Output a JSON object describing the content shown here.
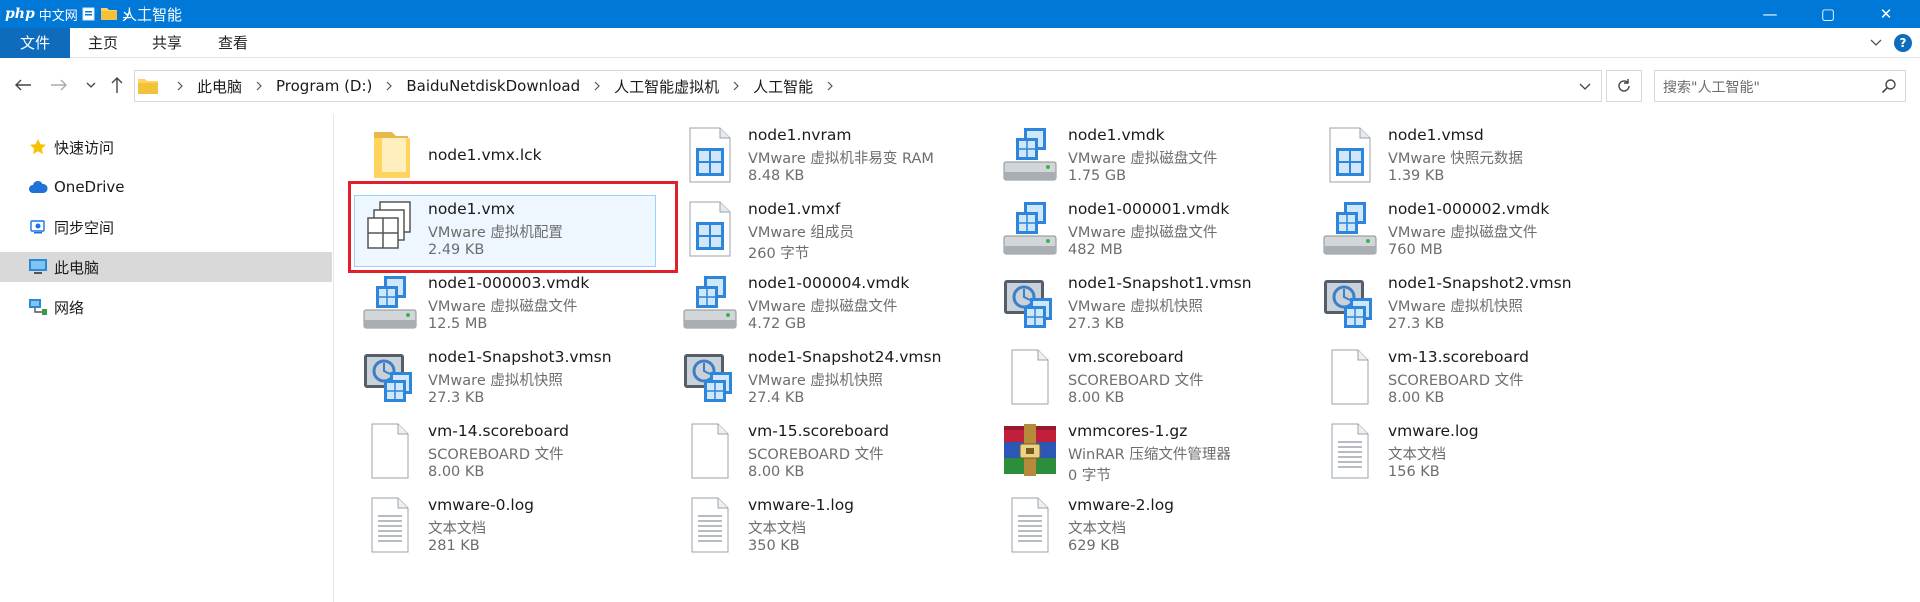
{
  "titlebar": {
    "badge_php": "php",
    "badge_cn": "中文网",
    "title": "人工智能",
    "minimize": "—",
    "maximize": "▢",
    "close": "✕"
  },
  "ribbon": {
    "tabs": [
      {
        "label": "文件"
      },
      {
        "label": "主页"
      },
      {
        "label": "共享"
      },
      {
        "label": "查看"
      }
    ],
    "help": "?"
  },
  "address": {
    "crumbs": [
      "此电脑",
      "Program (D:)",
      "BaiduNetdiskDownload",
      "人工智能虚拟机",
      "人工智能"
    ]
  },
  "search": {
    "placeholder": "搜索\"人工智能\""
  },
  "sidebar": {
    "items": [
      {
        "label": "快速访问",
        "icon": "star-icon",
        "color": "#f5c400"
      },
      {
        "label": "OneDrive",
        "icon": "cloud-icon",
        "color": "#1e72d8"
      },
      {
        "label": "同步空间",
        "icon": "sync-icon",
        "color": "#1a73e8"
      },
      {
        "label": "此电脑",
        "icon": "computer-icon",
        "color": "#2a8ad4"
      },
      {
        "label": "网络",
        "icon": "network-icon",
        "color": "#2a8ad4"
      }
    ]
  },
  "files": [
    {
      "name": "node1.vmx.lck",
      "type": "",
      "size": "",
      "icon": "folder-icon"
    },
    {
      "name": "node1.nvram",
      "type": "VMware 虚拟机非易变 RAM",
      "size": "8.48 KB",
      "icon": "vmware-doc-icon"
    },
    {
      "name": "node1.vmdk",
      "type": "VMware 虚拟磁盘文件",
      "size": "1.75 GB",
      "icon": "vmware-disk-icon"
    },
    {
      "name": "node1.vmsd",
      "type": "VMware 快照元数据",
      "size": "1.39 KB",
      "icon": "vmware-doc-icon"
    },
    {
      "name": "node1.vmx",
      "type": "VMware 虚拟机配置",
      "size": "2.49 KB",
      "icon": "vmware-config-icon"
    },
    {
      "name": "node1.vmxf",
      "type": "VMware 组成员",
      "size": "260 字节",
      "icon": "vmware-doc-icon"
    },
    {
      "name": "node1-000001.vmdk",
      "type": "VMware 虚拟磁盘文件",
      "size": "482 MB",
      "icon": "vmware-disk-icon"
    },
    {
      "name": "node1-000002.vmdk",
      "type": "VMware 虚拟磁盘文件",
      "size": "760 MB",
      "icon": "vmware-disk-icon"
    },
    {
      "name": "node1-000003.vmdk",
      "type": "VMware 虚拟磁盘文件",
      "size": "12.5 MB",
      "icon": "vmware-disk-icon"
    },
    {
      "name": "node1-000004.vmdk",
      "type": "VMware 虚拟磁盘文件",
      "size": "4.72 GB",
      "icon": "vmware-disk-icon"
    },
    {
      "name": "node1-Snapshot1.vmsn",
      "type": "VMware 虚拟机快照",
      "size": "27.3 KB",
      "icon": "vmware-snapshot-icon"
    },
    {
      "name": "node1-Snapshot2.vmsn",
      "type": "VMware 虚拟机快照",
      "size": "27.3 KB",
      "icon": "vmware-snapshot-icon"
    },
    {
      "name": "node1-Snapshot3.vmsn",
      "type": "VMware 虚拟机快照",
      "size": "27.3 KB",
      "icon": "vmware-snapshot-icon"
    },
    {
      "name": "node1-Snapshot24.vmsn",
      "type": "VMware 虚拟机快照",
      "size": "27.4 KB",
      "icon": "vmware-snapshot-icon"
    },
    {
      "name": "vm.scoreboard",
      "type": "SCOREBOARD 文件",
      "size": "8.00 KB",
      "icon": "blank-file-icon"
    },
    {
      "name": "vm-13.scoreboard",
      "type": "SCOREBOARD 文件",
      "size": "8.00 KB",
      "icon": "blank-file-icon"
    },
    {
      "name": "vm-14.scoreboard",
      "type": "SCOREBOARD 文件",
      "size": "8.00 KB",
      "icon": "blank-file-icon"
    },
    {
      "name": "vm-15.scoreboard",
      "type": "SCOREBOARD 文件",
      "size": "8.00 KB",
      "icon": "blank-file-icon"
    },
    {
      "name": "vmmcores-1.gz",
      "type": "WinRAR 压缩文件管理器",
      "size": "0 字节",
      "icon": "winrar-icon"
    },
    {
      "name": "vmware.log",
      "type": "文本文档",
      "size": "156 KB",
      "icon": "text-file-icon"
    },
    {
      "name": "vmware-0.log",
      "type": "文本文档",
      "size": "281 KB",
      "icon": "text-file-icon"
    },
    {
      "name": "vmware-1.log",
      "type": "文本文档",
      "size": "350 KB",
      "icon": "text-file-icon"
    },
    {
      "name": "vmware-2.log",
      "type": "文本文档",
      "size": "629 KB",
      "icon": "text-file-icon"
    }
  ],
  "colors": {
    "titlebar": "#0078d7",
    "highlight": "#e0202a",
    "vmware_blue": "#1d76d2"
  }
}
